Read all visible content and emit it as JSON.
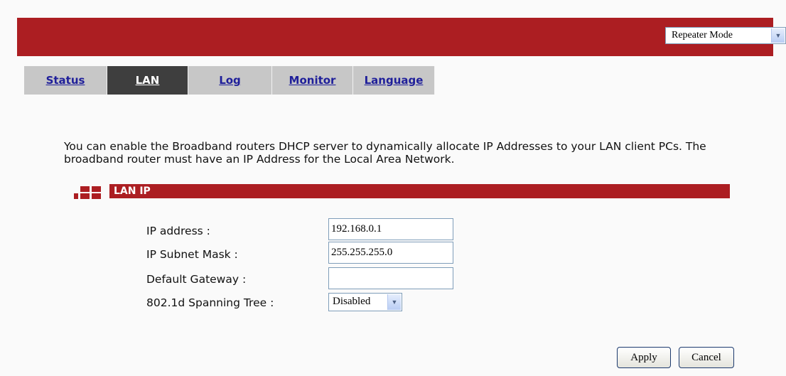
{
  "header": {
    "mode_select": "Repeater Mode"
  },
  "tabs": [
    {
      "label": "Status"
    },
    {
      "label": "LAN"
    },
    {
      "label": "Log"
    },
    {
      "label": "Monitor"
    },
    {
      "label": "Language"
    }
  ],
  "intro_text": "You can enable the Broadband routers DHCP server to dynamically allocate IP Addresses to your LAN client PCs. The broadband router must have an IP Address for the Local Area Network.",
  "section": {
    "title": "LAN IP"
  },
  "form": {
    "ip_address_label": "IP address :",
    "ip_address_value": "192.168.0.1",
    "subnet_label": "IP Subnet Mask :",
    "subnet_value": "255.255.255.0",
    "gateway_label": "Default Gateway :",
    "gateway_value": "",
    "stp_label": "802.1d Spanning Tree :",
    "stp_value": "Disabled"
  },
  "buttons": {
    "apply": "Apply",
    "cancel": "Cancel"
  },
  "colors": {
    "brand_red": "#ac1e22",
    "tab_inactive": "#c7c7c7",
    "tab_active": "#3e3e3e",
    "tab_link": "#1f1f9a"
  }
}
